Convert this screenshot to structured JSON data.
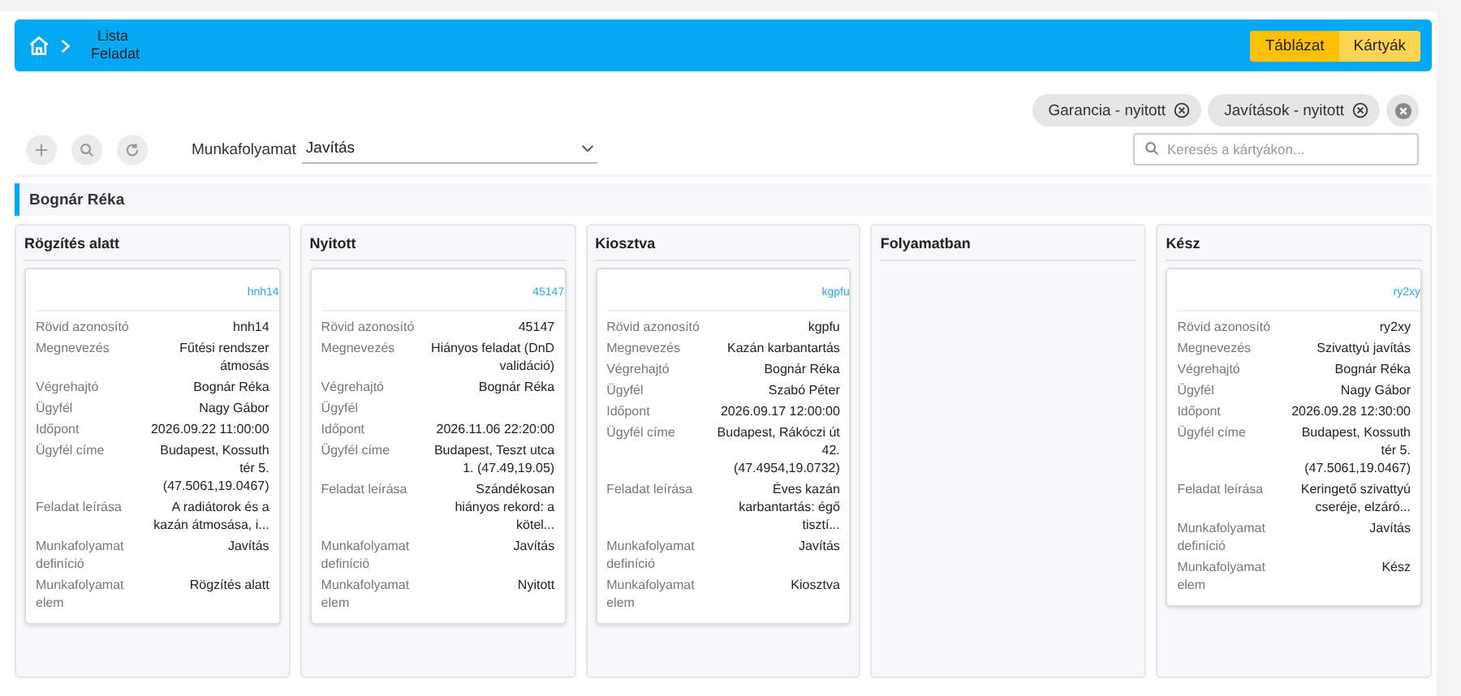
{
  "breadcrumb": {
    "items": [
      "Lista",
      "Feladat"
    ]
  },
  "view_toggle": [
    {
      "label": "Táblázat",
      "selected": false
    },
    {
      "label": "Kártyák",
      "selected": true
    }
  ],
  "filter_chips": [
    "Garancia - nyitott",
    "Javítások - nyitott"
  ],
  "search": {
    "placeholder": "Keresés a kártyákon..."
  },
  "workflow": {
    "label": "Munkafolyamat",
    "value": "Javítás"
  },
  "group": {
    "title": "Bognár Réka"
  },
  "columns": [
    {
      "title": "Rögzítés alatt",
      "cards": [
        {
          "tag": "hnh14",
          "fields": [
            {
              "label": "Rövid azonosító",
              "value": "hnh14"
            },
            {
              "label": "Megnevezés",
              "value": "Fűtési rendszer átmosás"
            },
            {
              "label": "Végrehajtó",
              "value": "Bognár Réka"
            },
            {
              "label": "Ügyfél",
              "value": "Nagy Gábor"
            },
            {
              "label": "Időpont",
              "value": "2026.09.22 11:00:00"
            },
            {
              "label": "Ügyfél címe",
              "value": "Budapest, Kossuth tér 5. (47.5061,19.0467)"
            },
            {
              "label": "Feladat leírása",
              "value": "A radiátorok és a kazán átmosása, i..."
            },
            {
              "label": "Munkafolyamat definíció",
              "value": "Javítás"
            },
            {
              "label": "Munkafolyamat elem",
              "value": "Rögzítés alatt"
            }
          ]
        }
      ]
    },
    {
      "title": "Nyitott",
      "cards": [
        {
          "tag": "45147",
          "fields": [
            {
              "label": "Rövid azonosító",
              "value": "45147"
            },
            {
              "label": "Megnevezés",
              "value": "Hiányos feladat (DnD validáció)"
            },
            {
              "label": "Végrehajtó",
              "value": "Bognár Réka"
            },
            {
              "label": "Ügyfél"
            },
            {
              "label": "Időpont",
              "value": "2026.11.06 22:20:00"
            },
            {
              "label": "Ügyfél címe",
              "value": "Budapest, Teszt utca 1. (47.49,19.05)"
            },
            {
              "label": "Feladat leírása",
              "value": "Szándékosan hiányos rekord: a kötel..."
            },
            {
              "label": "Munkafolyamat definíció",
              "value": "Javítás"
            },
            {
              "label": "Munkafolyamat elem",
              "value": "Nyitott"
            }
          ]
        }
      ]
    },
    {
      "title": "Kiosztva",
      "cards": [
        {
          "tag": "kgpfu",
          "fields": [
            {
              "label": "Rövid azonosító",
              "value": "kgpfu"
            },
            {
              "label": "Megnevezés",
              "value": "Kazán karbantartás"
            },
            {
              "label": "Végrehajtó",
              "value": "Bognár Réka"
            },
            {
              "label": "Ügyfél",
              "value": "Szabó Péter"
            },
            {
              "label": "Időpont",
              "value": "2026.09.17 12:00:00"
            },
            {
              "label": "Ügyfél címe",
              "value": "Budapest, Rákóczi út 42. (47.4954,19.0732)"
            },
            {
              "label": "Feladat leírása",
              "value": "Éves kazán karbantartás: égő tisztí..."
            },
            {
              "label": "Munkafolyamat definíció",
              "value": "Javítás"
            },
            {
              "label": "Munkafolyamat elem",
              "value": "Kiosztva"
            }
          ]
        }
      ]
    },
    {
      "title": "Folyamatban"
    },
    {
      "title": "Kész",
      "cards": [
        {
          "tag": "ry2xy",
          "fields": [
            {
              "label": "Rövid azonosító",
              "value": "ry2xy"
            },
            {
              "label": "Megnevezés",
              "value": "Szivattyú javítás"
            },
            {
              "label": "Végrehajtó",
              "value": "Bognár Réka"
            },
            {
              "label": "Ügyfél",
              "value": "Nagy Gábor"
            },
            {
              "label": "Időpont",
              "value": "2026.09.28 12:30:00"
            },
            {
              "label": "Ügyfél címe",
              "value": "Budapest, Kossuth tér 5. (47.5061,19.0467)"
            },
            {
              "label": "Feladat leírása",
              "value": "Keringető szivattyú cseréje, elzáró..."
            },
            {
              "label": "Munkafolyamat definíció",
              "value": "Javítás"
            },
            {
              "label": "Munkafolyamat elem",
              "value": "Kész"
            }
          ]
        }
      ]
    }
  ]
}
